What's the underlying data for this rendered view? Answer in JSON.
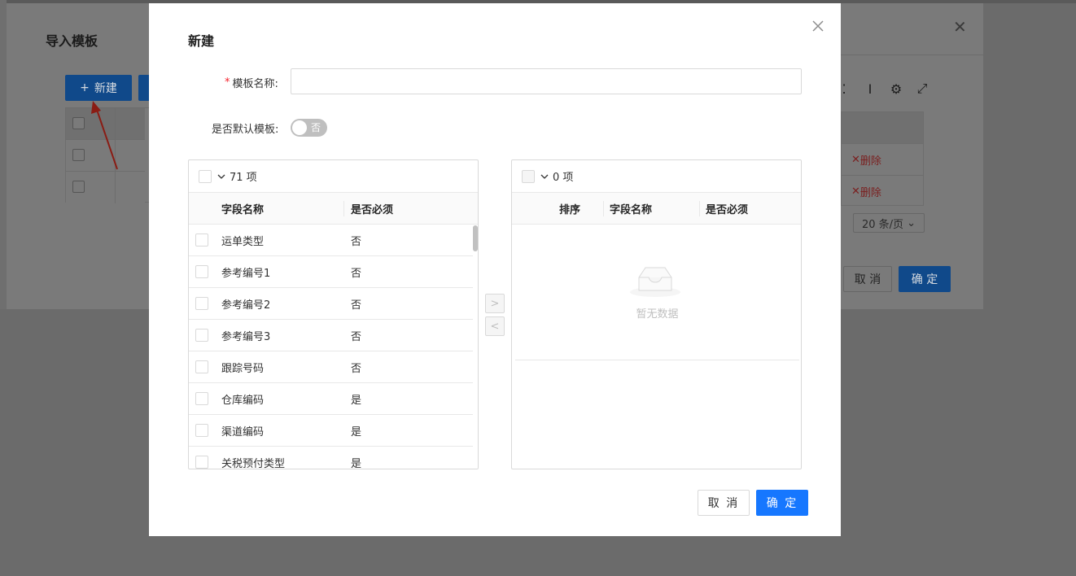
{
  "background": {
    "title": "导入模板",
    "new_button": "新建",
    "rows": [
      {
        "action": "删除"
      },
      {
        "action": "删除"
      }
    ],
    "page_size": "20 条/页",
    "cancel": "取 消",
    "ok": "确 定"
  },
  "modal": {
    "title": "新建",
    "template_name_label": "模板名称:",
    "template_name_value": "",
    "default_label": "是否默认模板:",
    "default_toggle_text": "否",
    "default_toggle_on": false,
    "source": {
      "count": "71 项",
      "col_name": "字段名称",
      "col_required": "是否必须",
      "rows": [
        {
          "name": "运单类型",
          "required": "否"
        },
        {
          "name": "参考编号1",
          "required": "否"
        },
        {
          "name": "参考编号2",
          "required": "否"
        },
        {
          "name": "参考编号3",
          "required": "否"
        },
        {
          "name": "跟踪号码",
          "required": "否"
        },
        {
          "name": "仓库编码",
          "required": "是"
        },
        {
          "name": "渠道编码",
          "required": "是"
        },
        {
          "name": "关税预付类型",
          "required": "是"
        }
      ]
    },
    "target": {
      "count": "0 项",
      "col_order": "排序",
      "col_name": "字段名称",
      "col_required": "是否必须",
      "empty_text": "暂无数据"
    },
    "move_right": ">",
    "move_left": "<",
    "cancel": "取 消",
    "ok": "确 定"
  },
  "colors": {
    "primary": "#1677ff",
    "danger": "#f5222d"
  }
}
